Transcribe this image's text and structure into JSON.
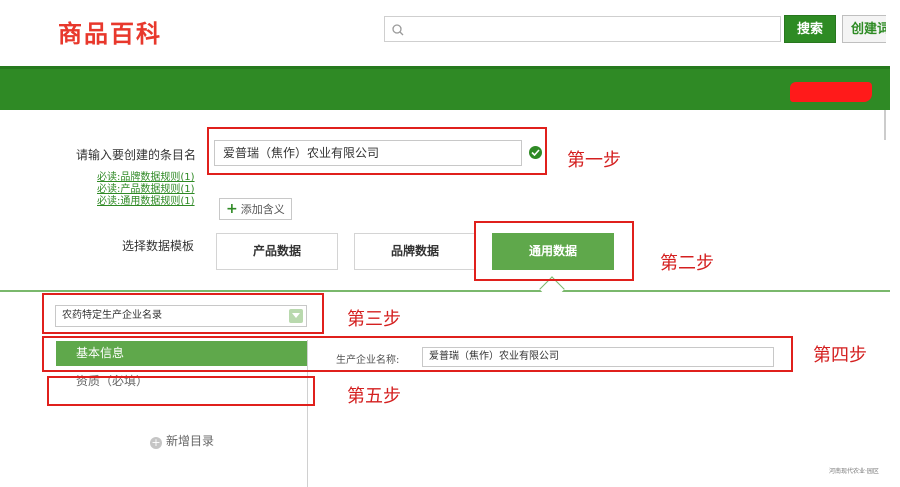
{
  "header": {
    "logo": "商品百科",
    "search": {
      "value": "",
      "placeholder": ""
    },
    "search_button": "搜索",
    "create_button": "创建词"
  },
  "form": {
    "entry_label": "请输入要创建的条目名",
    "entry_value": "爱普瑞（焦作）农业有限公司",
    "rule_links": [
      "必读:品牌数据规则(1)",
      "必读:产品数据规则(1)",
      "必读:通用数据规则(1)"
    ],
    "add_meaning": "添加含义",
    "template_label": "选择数据模板",
    "templates": [
      {
        "label": "产品数据",
        "selected": false
      },
      {
        "label": "品牌数据",
        "selected": false
      },
      {
        "label": "通用数据",
        "selected": true
      }
    ]
  },
  "category": {
    "selected": "农药特定生产企业名录"
  },
  "sidebar": {
    "items": [
      "基本信息",
      "资质（必填）"
    ],
    "add_directory": "新增目录"
  },
  "fields": [
    {
      "label": "生产企业名称:",
      "value": "爱普瑞（焦作）农业有限公司"
    }
  ],
  "annotations": {
    "step1": "第一步",
    "step2": "第二步",
    "step3": "第三步",
    "step4": "第四步",
    "step5": "第五步"
  },
  "watermark": "河南现代农业·园区",
  "colors": {
    "brand_green": "#2f8a25",
    "accent_green": "#5fa84b",
    "logo_red": "#e8382c",
    "annotation_red": "#e0201c"
  }
}
